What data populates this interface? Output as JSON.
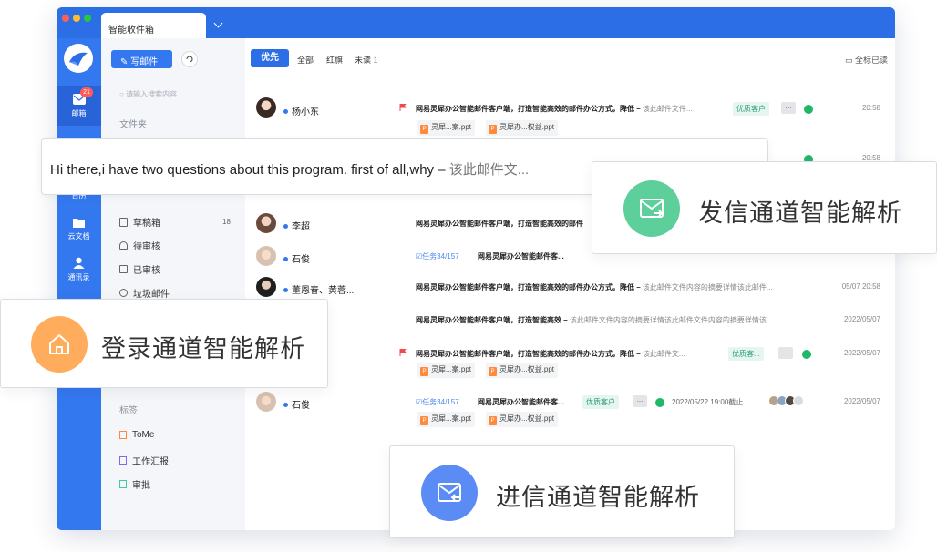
{
  "window": {
    "tab_title": "智能收件箱",
    "dots": [
      "#ff5f57",
      "#febc2e",
      "#28c840"
    ]
  },
  "rail": {
    "mail_label": "邮箱",
    "mail_badge": "21",
    "calendar_label": "日历",
    "docs_label": "云文档",
    "contacts_label": "通讯录"
  },
  "pane": {
    "compose_label": "写邮件",
    "search_placeholder": "请输入搜索内容",
    "folders_label": "文件夹",
    "folders": [
      {
        "name": "草稿箱",
        "count": "18"
      },
      {
        "name": "待审核",
        "count": ""
      },
      {
        "name": "已审核",
        "count": ""
      },
      {
        "name": "垃圾邮件",
        "count": ""
      }
    ],
    "tags_label": "标签",
    "tags": [
      {
        "name": "ToMe",
        "color": "#ff8a3d"
      },
      {
        "name": "工作汇报",
        "color": "#7a6cf0"
      },
      {
        "name": "审批",
        "color": "#3ccf9a"
      }
    ]
  },
  "filters": {
    "priority": "优先",
    "all": "全部",
    "flagged": "红旗",
    "unread": "未读",
    "unread_count": "1",
    "mark_all_read": "全标已读"
  },
  "rows": [
    {
      "sender": "杨小东",
      "subject": "网易灵犀办公智能邮件客户端，打造智能高效的邮件办公方式，降低 –",
      "snippet": "该此邮件文件...",
      "label": "优质客户",
      "time": "20:58",
      "att1": "灵犀...案.ppt",
      "att2": "灵犀办...权益.ppt"
    },
    {
      "time": "20:58"
    },
    {
      "sender": "李超",
      "subject": "网易灵犀办公智能邮件客户端，打造智能高效的邮件"
    },
    {
      "sender": "石俊",
      "task": "任务34/157",
      "subject": "网易灵犀办公智能邮件客..."
    },
    {
      "sender": "董恩春、黄蓉...",
      "subject": "网易灵犀办公智能邮件客户端，打造智能高效的邮件办公方式，降低 –",
      "snippet": "该此邮件文件内容的摘要详情该此邮件...",
      "time": "05/07 20:58"
    },
    {
      "subject": "网易灵犀办公智能邮件客户端，打造智能高效 –",
      "snippet": "该此邮件文件内容的摘要详情该此邮件文件内容的摘要详情该...",
      "time": "2022/05/07"
    },
    {
      "subject": "网易灵犀办公智能邮件客户端，打造智能高效的邮件办公方式，降低 –",
      "snippet": "该此邮件文...",
      "label": "优质客...",
      "time": "2022/05/07",
      "att1": "灵犀...案.ppt",
      "att2": "灵犀办...权益.ppt"
    },
    {
      "sender": "石俊",
      "task": "任务34/157",
      "subject": "网易灵犀办公智能邮件客...",
      "label": "优质客户",
      "deadline": "2022/05/22 19:00截止",
      "time": "2022/05/07",
      "att1": "灵犀...案.ppt",
      "att2": "灵犀办...权益.ppt"
    }
  ],
  "overlays": {
    "strip_text": "Hi there,i have two questions about this program. first of all,why –",
    "strip_snippet": "该此邮件文...",
    "send_card": "发信通道智能解析",
    "login_card": "登录通道智能解析",
    "receive_card": "进信通道智能解析"
  },
  "colors": {
    "brand": "#2b6ee6",
    "rail": "#3478f0",
    "send_icon": "#5ccf9a",
    "login_icon": "#ffad5c",
    "receive_icon": "#5b8cf5"
  }
}
